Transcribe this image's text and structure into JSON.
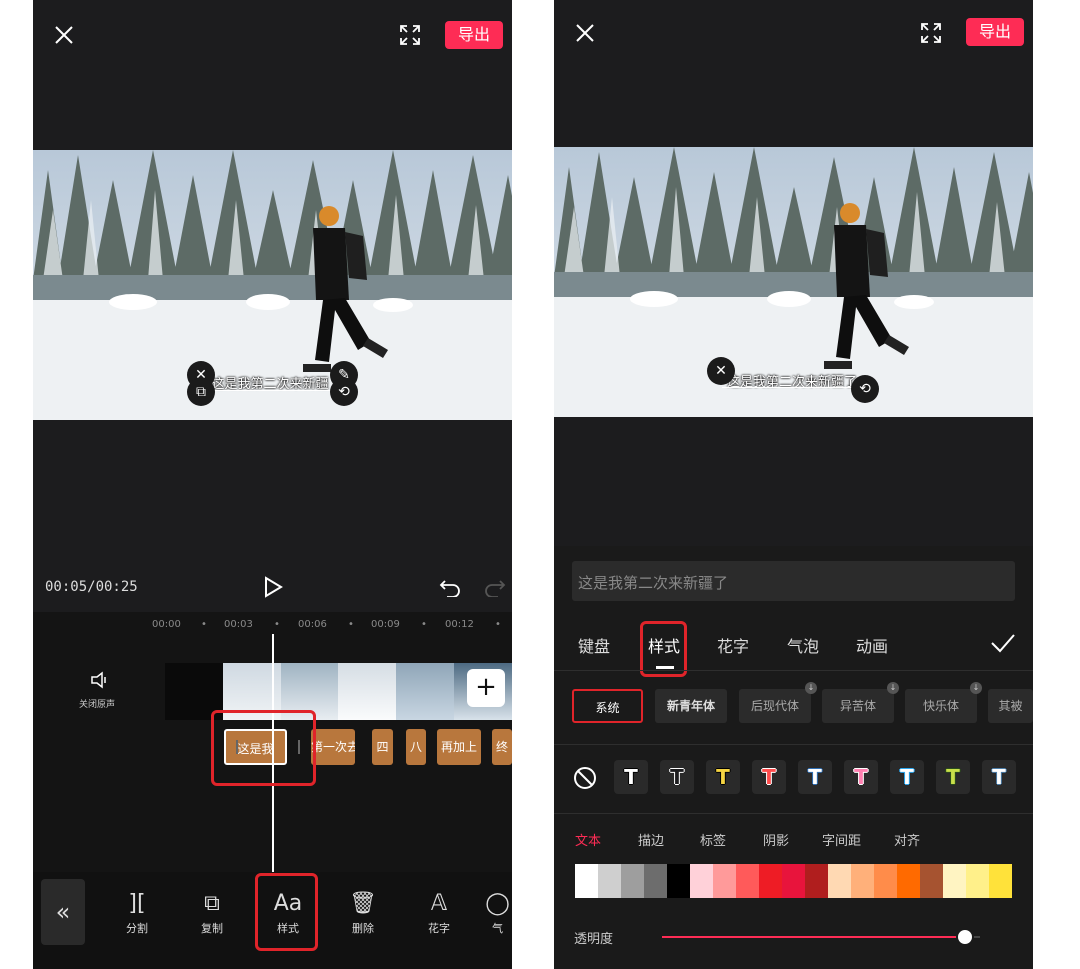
{
  "left": {
    "export_label": "导出",
    "subtitle": "这是我第二次来新疆",
    "time_display": "00:05/00:25",
    "ruler": [
      "00:00",
      "00:03",
      "00:06",
      "00:09",
      "00:12"
    ],
    "mute_label": "关闭原声",
    "segments": [
      "这是我",
      "第一次去",
      "四",
      "八",
      "再加上",
      "终"
    ],
    "tools": [
      {
        "icon": "split-icon",
        "label": "分割"
      },
      {
        "icon": "copy-icon",
        "label": "复制"
      },
      {
        "icon": "text-style-icon",
        "label": "样式"
      },
      {
        "icon": "delete-icon",
        "label": "删除"
      },
      {
        "icon": "fancy-text-icon",
        "label": "花字"
      },
      {
        "icon": "bubble-icon",
        "label": "气"
      }
    ]
  },
  "right": {
    "export_label": "导出",
    "subtitle": "这是我第二次来新疆了",
    "text_input_value": "这是我第二次来新疆了",
    "tabs": [
      "键盘",
      "样式",
      "花字",
      "气泡",
      "动画"
    ],
    "active_tab": "样式",
    "fonts": [
      "系统",
      "新青年体",
      "后现代体",
      "异苦体",
      "快乐体",
      "其被"
    ],
    "text_styles": [
      {
        "fill": "#ffffff",
        "stroke": "#000000"
      },
      {
        "fill": "#1c1c1e",
        "stroke": "#ffffff"
      },
      {
        "fill": "#f5d442",
        "stroke": "#000000"
      },
      {
        "fill": "#ff4d4d",
        "stroke": "#ffffff"
      },
      {
        "fill": "#ffffff",
        "stroke": "#2f6fb5"
      },
      {
        "fill": "#ff7fb0",
        "stroke": "#ffffff"
      },
      {
        "fill": "#ffffff",
        "stroke": "#2aa7f0"
      },
      {
        "fill": "#c9e04a",
        "stroke": "#2a4d1c"
      },
      {
        "fill": "#ffffff",
        "stroke": "#4a7ca8"
      }
    ],
    "subtabs": [
      "文本",
      "描边",
      "标签",
      "阴影",
      "字间距",
      "对齐"
    ],
    "active_subtab": "文本",
    "colors": [
      "#ffffff",
      "#cfcfcf",
      "#9e9e9e",
      "#6d6d6d",
      "#000000",
      "#ffd1d9",
      "#ff9a9a",
      "#ff5a5a",
      "#ee1c25",
      "#e8143c",
      "#b01e1e",
      "#ffd9b3",
      "#ffb07a",
      "#ff8c4a",
      "#ff6a00",
      "#a65330",
      "#fff4c2",
      "#fff08a",
      "#ffe23a",
      "#ffd400",
      "#ffc300"
    ],
    "opacity_label": "透明度",
    "opacity_value": 0.95
  },
  "accent": "#fe2c55",
  "highlight": "#e0242a"
}
